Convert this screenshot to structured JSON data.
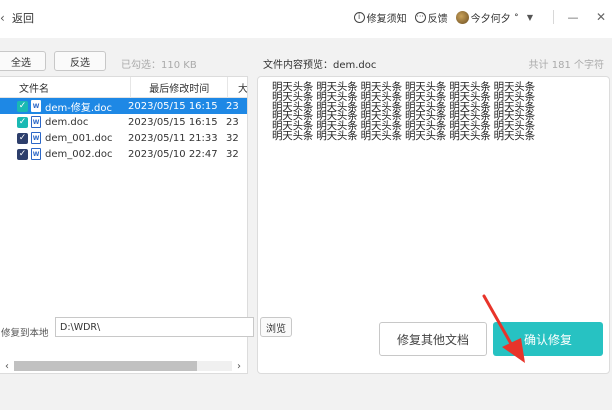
{
  "topbar": {
    "back_label": "返回",
    "help_label": "修复须知",
    "feedback_label": "反馈",
    "user_name": "今夕何夕 ˚",
    "minimize_glyph": "—",
    "close_glyph": "✕"
  },
  "toolbar": {
    "select_all": "全选",
    "invert": "反选",
    "selected_info": "已勾选：110 KB"
  },
  "preview": {
    "title": "文件内容预览：dem.doc",
    "count": "共计 181 个字符",
    "lines": [
      "明天头条 明天头条 明天头条 明天头条 明天头条 明天头条",
      "明天头条 明天头条 明天头条 明天头条 明天头条 明天头条",
      "明天头条 明天头条 明天头条 明天头条 明天头条 明天头条",
      "明天头条 明天头条 明天头条 明天头条 明天头条 明天头条",
      "明天头条 明天头条 明天头条 明天头条 明天头条 明天头条",
      "明天头条 明天头条 明天头条 明天头条 明天头条 明天头条"
    ]
  },
  "file_list": {
    "columns": [
      "文件名",
      "最后修改时间",
      "大"
    ],
    "rows": [
      {
        "name": "dem-修复.doc",
        "date": "2023/05/15 16:15",
        "size": "23",
        "selected": true,
        "check": "teal"
      },
      {
        "name": "dem.doc",
        "date": "2023/05/15 16:15",
        "size": "23",
        "selected": false,
        "check": "teal"
      },
      {
        "name": "dem_001.doc",
        "date": "2023/05/11 21:33",
        "size": "32",
        "selected": false,
        "check": "navy"
      },
      {
        "name": "dem_002.doc",
        "date": "2023/05/10 22:47",
        "size": "32",
        "selected": false,
        "check": "navy"
      }
    ],
    "scroll_left": "‹",
    "scroll_right": "›"
  },
  "bottom": {
    "restore_label": "修复到本地",
    "path_value": "D:\\WDR\\",
    "browse": "浏览",
    "other_docs": "修复其他文档",
    "confirm": "确认修复"
  },
  "colors": {
    "accent": "#27c2c2",
    "selection": "#1e88e5",
    "arrow": "#e8342a"
  }
}
